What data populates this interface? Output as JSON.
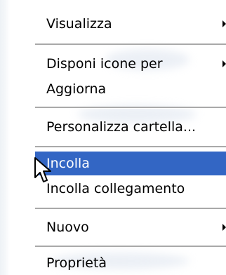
{
  "menu": {
    "items": [
      {
        "label": "Visualizza",
        "has_submenu": true
      },
      {
        "label": "Disponi icone per",
        "has_submenu": true
      },
      {
        "label": "Aggiorna",
        "has_submenu": false
      },
      {
        "label": "Personalizza cartella...",
        "has_submenu": false
      },
      {
        "label": "Incolla",
        "has_submenu": false,
        "highlighted": true
      },
      {
        "label": "Incolla collegamento",
        "has_submenu": false
      },
      {
        "label": "Nuovo",
        "has_submenu": true
      },
      {
        "label": "Proprietà",
        "has_submenu": false
      }
    ]
  },
  "colors": {
    "highlight": "#3366c4",
    "separator": "#a9a9a9",
    "text": "#000000",
    "highlight_text": "#ffffff"
  },
  "icons": {
    "cursor": "pointer-cursor-icon",
    "submenu": "submenu-arrow-icon"
  }
}
